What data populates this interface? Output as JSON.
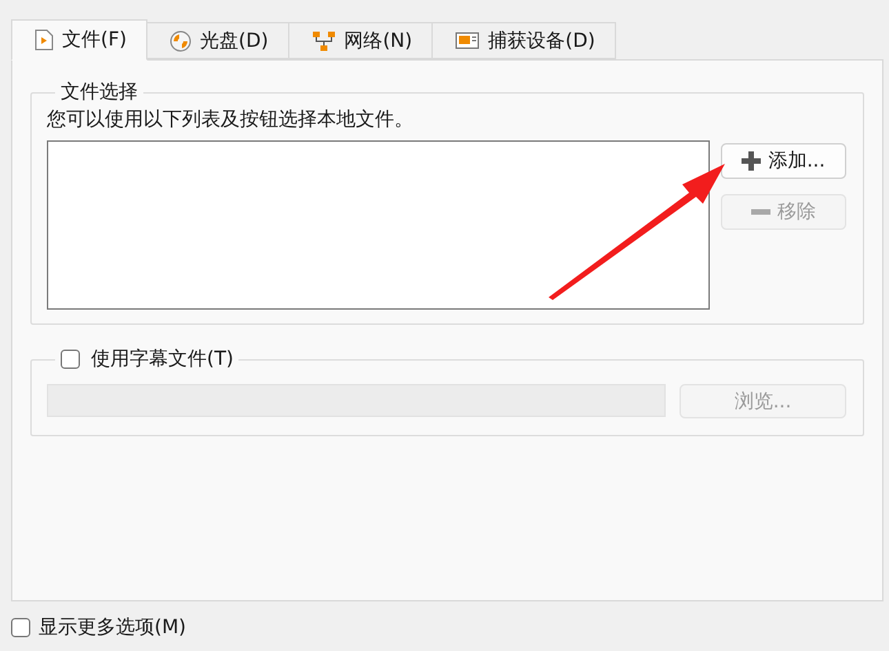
{
  "tabs": [
    {
      "label": "文件(F)",
      "kind": "file",
      "selected": true
    },
    {
      "label": "光盘(D)",
      "kind": "disc",
      "selected": false
    },
    {
      "label": "网络(N)",
      "kind": "network",
      "selected": false
    },
    {
      "label": "捕获设备(D)",
      "kind": "capture",
      "selected": false
    }
  ],
  "file_selection": {
    "title": "文件选择",
    "description": "您可以使用以下列表及按钮选择本地文件。",
    "buttons": [
      {
        "label": "添加...",
        "kind": "add",
        "disabled": false
      },
      {
        "label": "移除",
        "kind": "remove",
        "disabled": true
      }
    ]
  },
  "subtitle": {
    "label": "使用字幕文件(T)",
    "checked": false,
    "field_disabled": true,
    "browse": {
      "label": "浏览...",
      "disabled": true
    }
  },
  "more_options": {
    "label": "显示更多选项(M)",
    "checked": false
  },
  "annotation": {
    "kind": "arrow"
  }
}
